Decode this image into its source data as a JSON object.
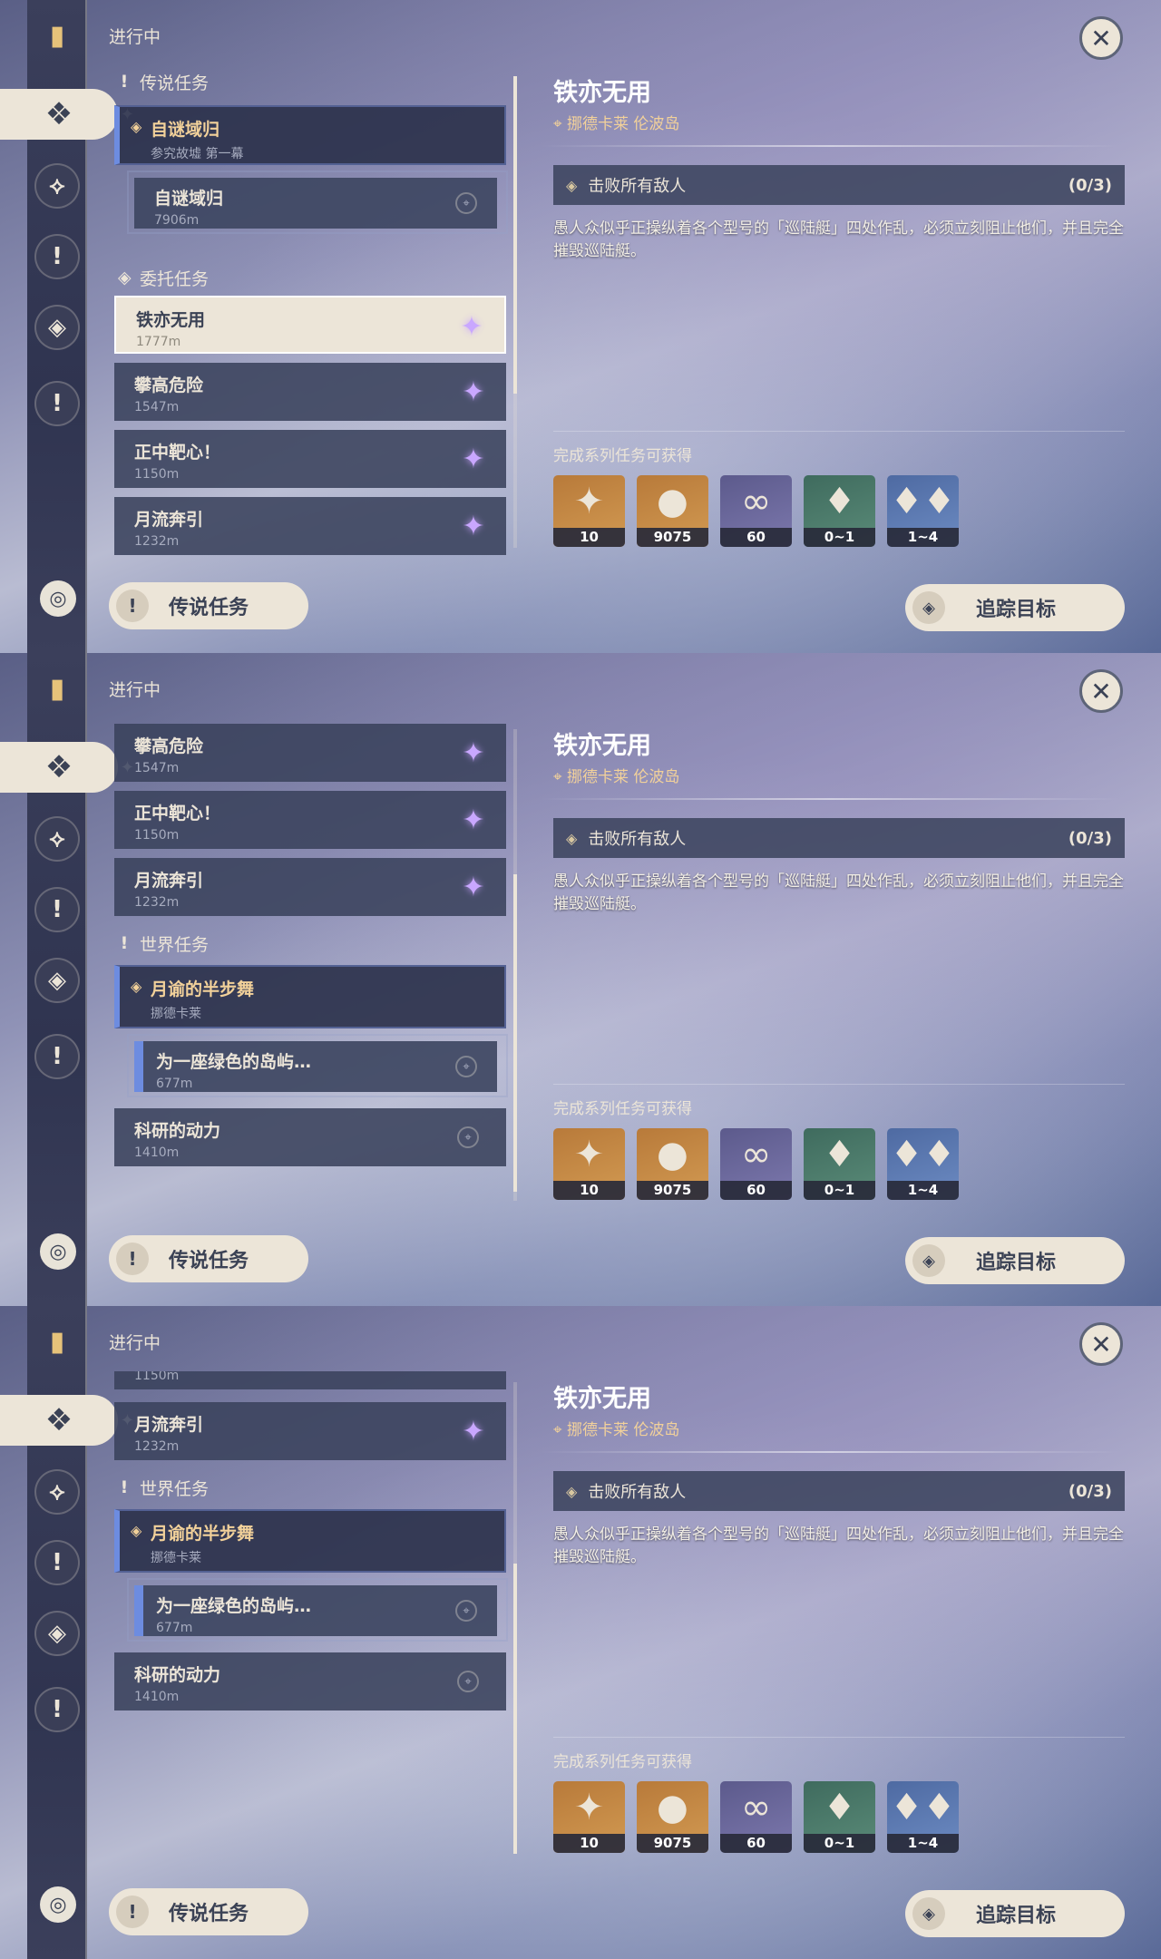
{
  "header": {
    "in_progress": "进行中"
  },
  "categories": {
    "legend": "传说任务",
    "commission": "委托任务",
    "world": "世界任务"
  },
  "quests": {
    "legend_parent": {
      "title": "自谜域归",
      "sub": "参究故墟 第一幕"
    },
    "legend_child": {
      "title": "自谜域归",
      "dist": "7906m"
    },
    "q1": {
      "title": "铁亦无用",
      "dist": "1777m"
    },
    "q2": {
      "title": "攀高危险",
      "dist": "1547m"
    },
    "q3": {
      "title": "正中靶心！",
      "dist": "1150m"
    },
    "q4": {
      "title": "月流奔引",
      "dist": "1232m"
    },
    "world_parent": {
      "title": "月谕的半步舞",
      "sub": "挪德卡莱"
    },
    "world_child": {
      "title": "为一座绿色的岛屿…",
      "dist": "677m"
    },
    "world2": {
      "title": "科研的动力",
      "dist": "1410m"
    }
  },
  "detail": {
    "title": "铁亦无用",
    "location": "挪德卡莱 伦波岛",
    "objective": "击败所有敌人",
    "objective_count": "(0/3)",
    "description": "愚人众似乎正操纵着各个型号的「巡陆艇」四处作乱，必须立刻阻止他们，并且完全摧毁巡陆艇。",
    "rewards_label": "完成系列任务可获得",
    "rewards": [
      {
        "icon": "primogem-icon",
        "qty": "10"
      },
      {
        "icon": "mora-icon",
        "qty": "9075"
      },
      {
        "icon": "companionship-exp-icon",
        "qty": "60"
      },
      {
        "icon": "crystal-icon",
        "qty": "0~1"
      },
      {
        "icon": "crystal-cluster-icon",
        "qty": "1~4"
      }
    ]
  },
  "buttons": {
    "legend_quests": "传说任务",
    "track": "追踪目标"
  },
  "colors": {
    "accent_gold": "#f2d19a",
    "panel_cream": "#ece5d8",
    "card_bg": "#3a425c"
  }
}
